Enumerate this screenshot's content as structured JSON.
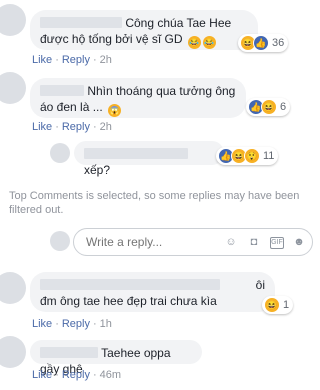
{
  "comments": [
    {
      "text": "Công chúa Tae Hee được hộ tống bởi vệ sĩ GD",
      "like": "Like",
      "reply": "Reply",
      "time": "2h",
      "reaction_count": "36"
    },
    {
      "text": "Nhìn thoáng qua tưởng ông áo đen là ...",
      "like": "Like",
      "reply": "Reply",
      "time": "2h",
      "reaction_count": "6"
    },
    {
      "text": "xếp?",
      "reaction_count": "11"
    },
    {
      "text_a": "ôi",
      "text_b": "đm ông tae hee đẹp trai chưa kìa",
      "like": "Like",
      "reply": "Reply",
      "time": "1h",
      "reaction_count": "1"
    },
    {
      "text": "Taehee oppa gầy ghê",
      "like": "Like",
      "reply": "Reply",
      "time": "46m"
    }
  ],
  "notice": "Top Comments is selected, so some replies may have been filtered out.",
  "reply_box": {
    "placeholder": "Write a reply..."
  },
  "icons": [
    "smiley-icon",
    "camera-icon",
    "gif-icon",
    "sticker-icon"
  ]
}
